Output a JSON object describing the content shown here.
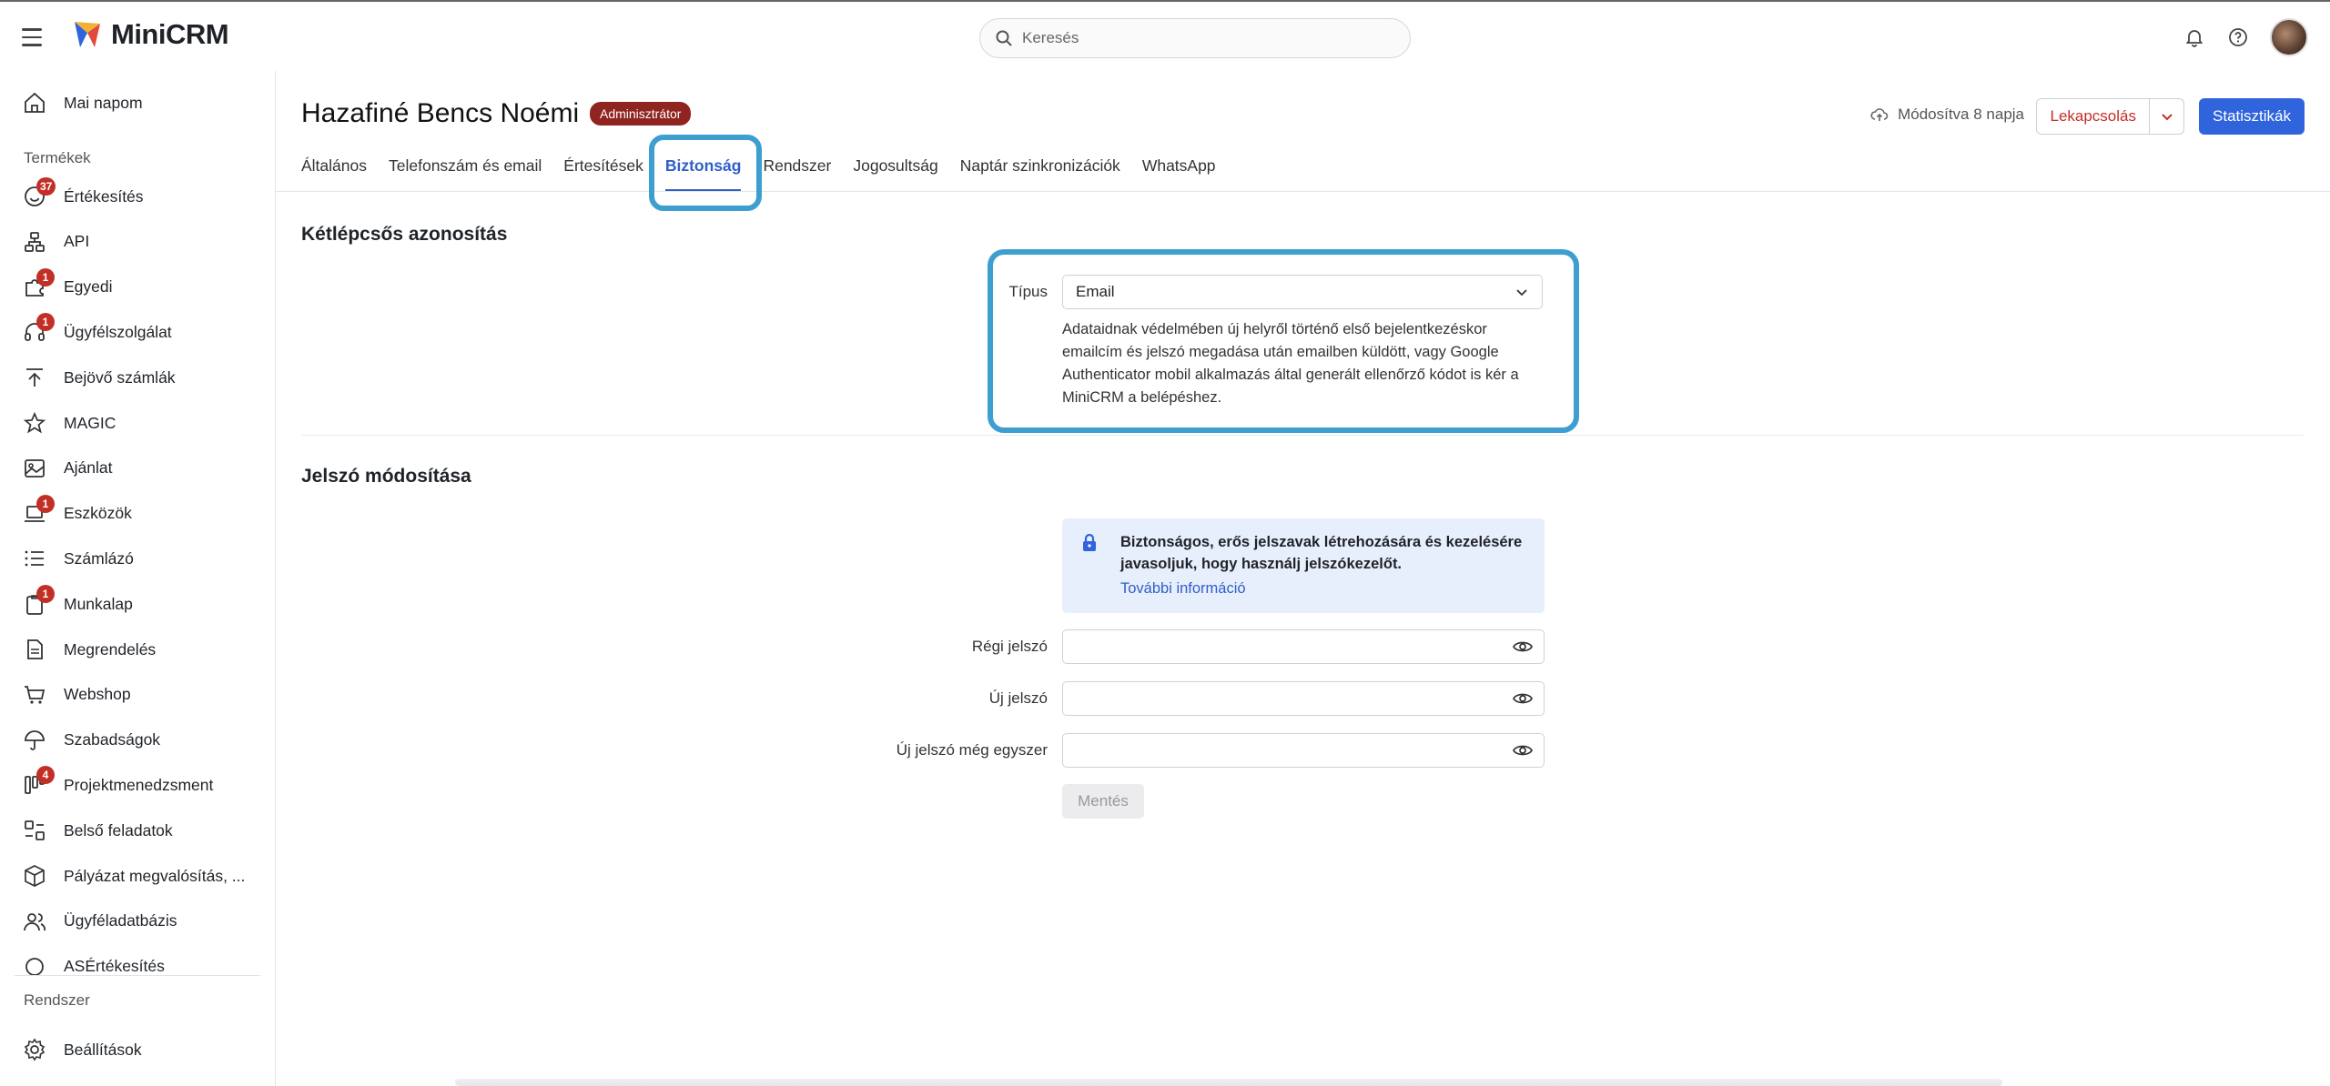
{
  "topbar": {
    "logo_text": "MiniCRM",
    "search_placeholder": "Keresés"
  },
  "sidebar": {
    "top_item": "Mai napom",
    "section_products": "Termékek",
    "items": [
      {
        "label": "Értékesítés",
        "badge": "37",
        "icon": "smile-icon"
      },
      {
        "label": "API",
        "badge": "",
        "icon": "api-icon"
      },
      {
        "label": "Egyedi",
        "badge": "1",
        "icon": "puzzle-icon"
      },
      {
        "label": "Ügyfélszolgálat",
        "badge": "1",
        "icon": "headset-icon"
      },
      {
        "label": "Bejövő számlák",
        "badge": "",
        "icon": "arrow-up-icon"
      },
      {
        "label": "MAGIC",
        "badge": "",
        "icon": "star-icon"
      },
      {
        "label": "Ajánlat",
        "badge": "",
        "icon": "image-icon"
      },
      {
        "label": "Eszközök",
        "badge": "1",
        "icon": "laptop-icon"
      },
      {
        "label": "Számlázó",
        "badge": "",
        "icon": "list-icon"
      },
      {
        "label": "Munkalap",
        "badge": "1",
        "icon": "clipboard-icon"
      },
      {
        "label": "Megrendelés",
        "badge": "",
        "icon": "document-icon"
      },
      {
        "label": "Webshop",
        "badge": "",
        "icon": "cart-icon"
      },
      {
        "label": "Szabadságok",
        "badge": "",
        "icon": "umbrella-icon"
      },
      {
        "label": "Projektmenedzsment",
        "badge": "4",
        "icon": "kanban-icon"
      },
      {
        "label": "Belső feladatok",
        "badge": "",
        "icon": "tasks-icon"
      },
      {
        "label": "Pályázat megvalósítás, ...",
        "badge": "",
        "icon": "box-icon"
      },
      {
        "label": "Ügyféladatbázis",
        "badge": "",
        "icon": "users-icon"
      },
      {
        "label": "ASÉrtékesítés",
        "badge": "",
        "icon": "circle-icon"
      }
    ],
    "section_system": "Rendszer",
    "settings_label": "Beállítások"
  },
  "header": {
    "user_name": "Hazafiné Bencs Noémi",
    "role_badge": "Adminisztrátor",
    "modified": "Módosítva 8 napja",
    "lock_button": "Lekapcsolás",
    "stats_button": "Statisztikák"
  },
  "tabs": [
    {
      "label": "Általános",
      "active": false
    },
    {
      "label": "Telefonszám és email",
      "active": false
    },
    {
      "label": "Értesítések",
      "active": false
    },
    {
      "label": "Biztonság",
      "active": true
    },
    {
      "label": "Rendszer",
      "active": false
    },
    {
      "label": "Jogosultság",
      "active": false
    },
    {
      "label": "Naptár szinkronizációk",
      "active": false
    },
    {
      "label": "WhatsApp",
      "active": false
    }
  ],
  "two_factor": {
    "title": "Kétlépcsős azonosítás",
    "type_label": "Típus",
    "type_value": "Email",
    "help_text": "Adataidnak védelmében új helyről történő első bejelentkezéskor emailcím és jelszó megadása után emailben küldött, vagy Google Authenticator mobil alkalmazás által generált ellenőrző kódot is kér a MiniCRM a belépéshez."
  },
  "password": {
    "title": "Jelszó módosítása",
    "info_text": "Biztonságos, erős jelszavak létrehozására és kezelésére javasoljuk, hogy használj jelszókezelőt.",
    "info_link": "További információ",
    "old_label": "Régi jelszó",
    "new_label": "Új jelszó",
    "repeat_label": "Új jelszó még egyszer",
    "save_button": "Mentés"
  },
  "colors": {
    "accent": "#2f64dc",
    "highlight": "#3d9fd0",
    "badge_red": "#c22f26"
  }
}
